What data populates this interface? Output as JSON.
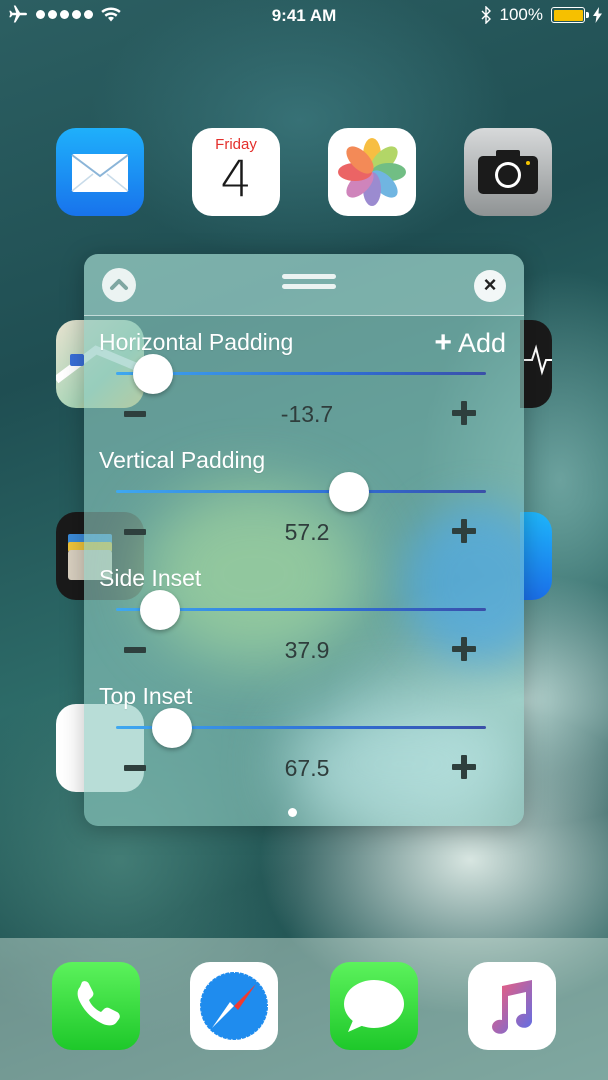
{
  "status_bar": {
    "time": "9:41 AM",
    "battery": "100%",
    "battery_level": 1.0,
    "signal_bars": 5,
    "icons": [
      "airplane-icon",
      "signal-dots-icon",
      "wifi-icon",
      "bluetooth-icon",
      "battery-icon",
      "charging-icon"
    ]
  },
  "home_screen": {
    "apps_row1": [
      "mail-icon",
      "calendar-icon",
      "photos-icon",
      "camera-icon"
    ],
    "calendar": {
      "day": "Friday",
      "date": "4"
    },
    "dock": [
      "phone-icon",
      "safari-icon",
      "messages-icon",
      "music-icon"
    ]
  },
  "panel": {
    "header": {
      "collapse_icon": "chevron-up-icon",
      "grabber_icon": "drag-handle-icon",
      "close_icon": "close-icon",
      "close_glyph": "×"
    },
    "add_label": "Add",
    "add_glyph": "+",
    "sliders": [
      {
        "label": "Horizontal Padding",
        "value": "-13.7",
        "fraction": 0.1
      },
      {
        "label": "Vertical Padding",
        "value": "57.2",
        "fraction": 0.63
      },
      {
        "label": "Side Inset",
        "value": "37.9",
        "fraction": 0.12
      },
      {
        "label": "Top Inset",
        "value": "67.5",
        "fraction": 0.15
      }
    ],
    "page_indicator": {
      "pages": 1,
      "current": 1
    }
  },
  "colors": {
    "slider_track": "#2f6fd6",
    "calendar_day": "#e4302c",
    "battery_fill": "#f6c000",
    "dock_green": "#1ec82a"
  }
}
